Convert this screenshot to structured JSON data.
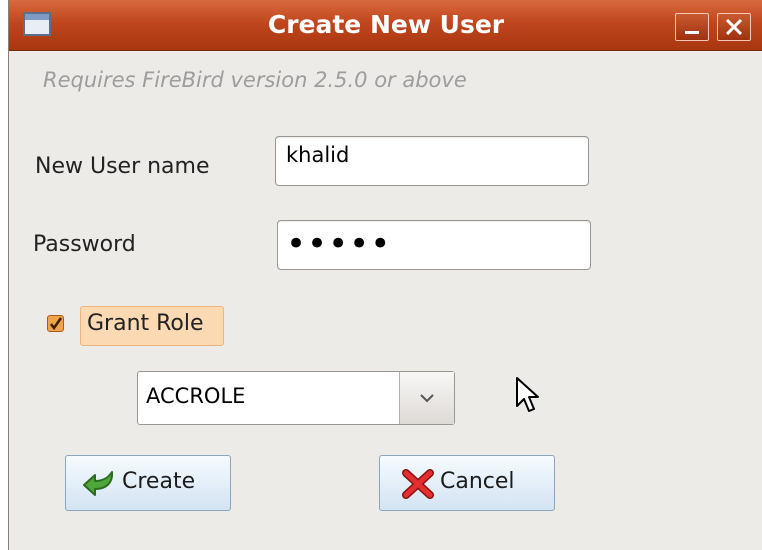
{
  "window": {
    "title": "Create New User"
  },
  "form": {
    "subtitle": "Requires FireBird version 2.5.0 or above",
    "username_label": "New User name",
    "username_value": "khalid",
    "password_label": "Password",
    "password_value": "•••••",
    "grant_role_label": "Grant Role",
    "grant_role_checked": true,
    "role_selected": "ACCROLE"
  },
  "buttons": {
    "create_label": "Create",
    "cancel_label": "Cancel"
  },
  "colors": {
    "titlebar": "#c0461e",
    "checkbox": "#f0a34b",
    "highlight": "#fad9b3"
  },
  "icons": {
    "create": "green-curved-arrow-icon",
    "cancel": "red-x-icon"
  }
}
